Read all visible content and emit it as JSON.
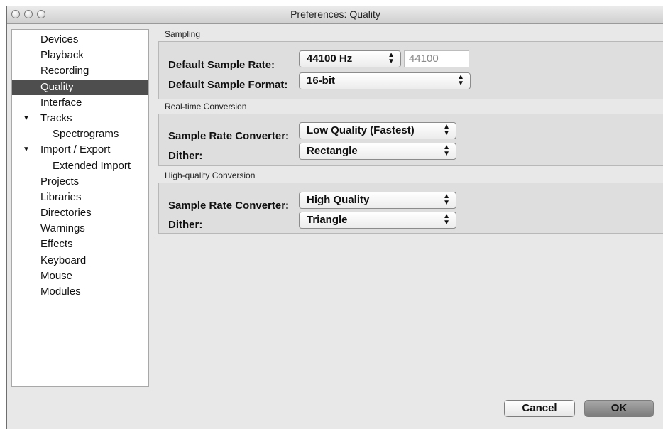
{
  "window": {
    "title": "Preferences: Quality"
  },
  "sidebar": {
    "items": [
      {
        "label": "Devices"
      },
      {
        "label": "Playback"
      },
      {
        "label": "Recording"
      },
      {
        "label": "Quality"
      },
      {
        "label": "Interface"
      },
      {
        "label": "Tracks"
      },
      {
        "label": "Spectrograms"
      },
      {
        "label": "Import / Export"
      },
      {
        "label": "Extended Import"
      },
      {
        "label": "Projects"
      },
      {
        "label": "Libraries"
      },
      {
        "label": "Directories"
      },
      {
        "label": "Warnings"
      },
      {
        "label": "Effects"
      },
      {
        "label": "Keyboard"
      },
      {
        "label": "Mouse"
      },
      {
        "label": "Modules"
      }
    ],
    "selected": "Quality",
    "expander_glyph": "▼"
  },
  "sampling": {
    "heading": "Sampling",
    "rate_label": "Default Sample Rate:",
    "rate_value": "44100 Hz",
    "rate_text": "44100",
    "format_label": "Default Sample Format:",
    "format_value": "16-bit"
  },
  "realtime": {
    "heading": "Real-time Conversion",
    "converter_label": "Sample Rate Converter:",
    "converter_value": "Low Quality (Fastest)",
    "dither_label": "Dither:",
    "dither_value": "Rectangle"
  },
  "highquality": {
    "heading": "High-quality Conversion",
    "converter_label": "Sample Rate Converter:",
    "converter_value": "High Quality",
    "dither_label": "Dither:",
    "dither_value": "Triangle"
  },
  "buttons": {
    "cancel": "Cancel",
    "ok": "OK"
  },
  "colors": {
    "selection": "#4e4e4e",
    "panel": "#e8e8e8"
  }
}
